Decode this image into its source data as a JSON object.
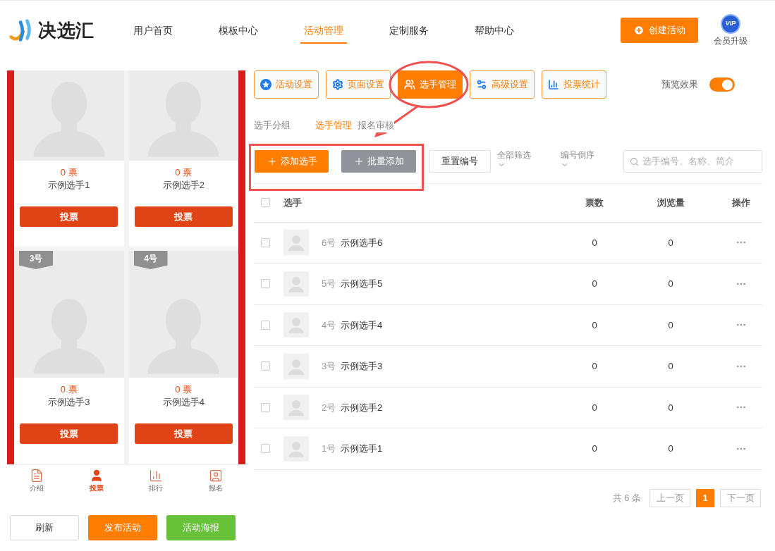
{
  "logo": {
    "text": "决选汇"
  },
  "nav": [
    {
      "label": "用户首页",
      "selected": false
    },
    {
      "label": "模板中心",
      "selected": false
    },
    {
      "label": "活动管理",
      "selected": true
    },
    {
      "label": "定制服务",
      "selected": false
    },
    {
      "label": "帮助中心",
      "selected": false
    }
  ],
  "create_button": "创建活动",
  "vip": {
    "badge": "VIP",
    "label": "会员升级"
  },
  "preview": {
    "cards": [
      {
        "votes": "0 票",
        "name": "示例选手1",
        "button": "投票"
      },
      {
        "votes": "0 票",
        "name": "示例选手2",
        "button": "投票"
      },
      {
        "number": "3号",
        "votes": "0 票",
        "name": "示例选手3",
        "button": "投票"
      },
      {
        "number": "4号",
        "votes": "0 票",
        "name": "示例选手4",
        "button": "投票"
      }
    ],
    "tabbar": [
      {
        "label": "介绍",
        "kind": "intro",
        "selected": false
      },
      {
        "label": "投票",
        "kind": "vote",
        "selected": true
      },
      {
        "label": "排行",
        "kind": "rank",
        "selected": false
      },
      {
        "label": "报名",
        "kind": "signup",
        "selected": false
      }
    ]
  },
  "bottom_buttons": [
    {
      "label": "刷新",
      "kind": "outline"
    },
    {
      "label": "发布活动",
      "kind": "primary"
    },
    {
      "label": "活动海报",
      "kind": "success"
    }
  ],
  "settings_tabs": [
    {
      "label": "活动设置",
      "kind": "star",
      "selected": false
    },
    {
      "label": "页面设置",
      "kind": "gear",
      "selected": false
    },
    {
      "label": "选手管理",
      "kind": "users",
      "selected": true
    },
    {
      "label": "高级设置",
      "kind": "advanced",
      "selected": false
    },
    {
      "label": "投票统计",
      "kind": "stats",
      "selected": false
    }
  ],
  "preview_toggle": {
    "label": "预览效果",
    "on": true
  },
  "sub_tabs": [
    {
      "label": "选手分组",
      "selected": false
    },
    {
      "label": "选手管理",
      "selected": true
    },
    {
      "label": "报名审核",
      "selected": false
    }
  ],
  "toolbar": {
    "add_button": "添加选手",
    "batch_button": "批量添加",
    "reset_button": "重置编号",
    "filter": "全部筛选",
    "sort": "编号倒序",
    "search": {
      "placeholder": "选手编号、名称、简介"
    }
  },
  "table": {
    "select_all_checked": false,
    "columns": [
      "选手",
      "票数",
      "浏览量",
      "操作"
    ],
    "rows": [
      {
        "checked": false,
        "number": "6号",
        "name": "示例选手6",
        "votes": "0",
        "views": "0"
      },
      {
        "checked": false,
        "number": "5号",
        "name": "示例选手5",
        "votes": "0",
        "views": "0"
      },
      {
        "checked": false,
        "number": "4号",
        "name": "示例选手4",
        "votes": "0",
        "views": "0"
      },
      {
        "checked": false,
        "number": "3号",
        "name": "示例选手3",
        "votes": "0",
        "views": "0"
      },
      {
        "checked": false,
        "number": "2号",
        "name": "示例选手2",
        "votes": "0",
        "views": "0"
      },
      {
        "checked": false,
        "number": "1号",
        "name": "示例选手1",
        "votes": "0",
        "views": "0"
      }
    ]
  },
  "pagination": {
    "total": "共 6 条",
    "prev": "上一页",
    "pages": [
      {
        "label": "1",
        "selected": true
      }
    ],
    "next": "下一页"
  }
}
